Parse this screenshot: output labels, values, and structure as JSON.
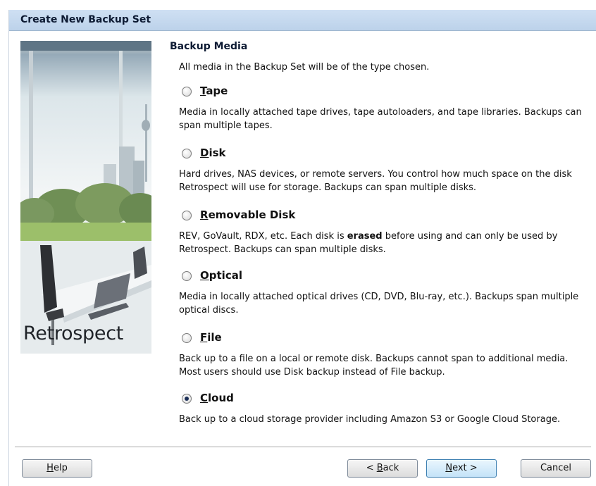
{
  "dialog": {
    "title": "Create New Backup Set"
  },
  "branding": {
    "text": "Retrospect"
  },
  "backup_media": {
    "title": "Backup Media",
    "subtitle": "All media in the Backup Set will be of the type chosen.",
    "selected": "cloud",
    "options": [
      {
        "id": "tape",
        "accel": "T",
        "rest": "ape",
        "description": "Media in locally attached tape drives, tape autoloaders, and tape libraries. Backups can span multiple tapes."
      },
      {
        "id": "disk",
        "accel": "D",
        "rest": "isk",
        "description": "Hard drives, NAS devices, or remote servers. You control how much space on the disk Retrospect will use for storage. Backups can span multiple disks."
      },
      {
        "id": "removable-disk",
        "accel": "R",
        "rest": "emovable Disk",
        "desc_before": "REV, GoVault, RDX, etc. Each disk is ",
        "desc_bold": "erased",
        "desc_after": " before using and can only be used by Retrospect. Backups can span multiple disks."
      },
      {
        "id": "optical",
        "accel": "O",
        "rest": "ptical",
        "description": "Media in locally attached optical drives (CD, DVD, Blu-ray, etc.). Backups span multiple optical discs."
      },
      {
        "id": "file",
        "accel": "F",
        "rest": "ile",
        "description": "Back up to a file on a local or remote disk. Backups cannot span to additional media. Most users should use Disk backup instead of File backup."
      },
      {
        "id": "cloud",
        "accel": "C",
        "rest": "loud",
        "description": "Back up to a cloud storage provider including Amazon S3 or Google Cloud Storage."
      }
    ]
  },
  "buttons": {
    "help": {
      "accel": "H",
      "rest": "elp"
    },
    "back": {
      "prefix": "< ",
      "accel": "B",
      "rest": "ack"
    },
    "next": {
      "accel": "N",
      "rest": "ext >"
    },
    "cancel": {
      "label": "Cancel"
    }
  }
}
